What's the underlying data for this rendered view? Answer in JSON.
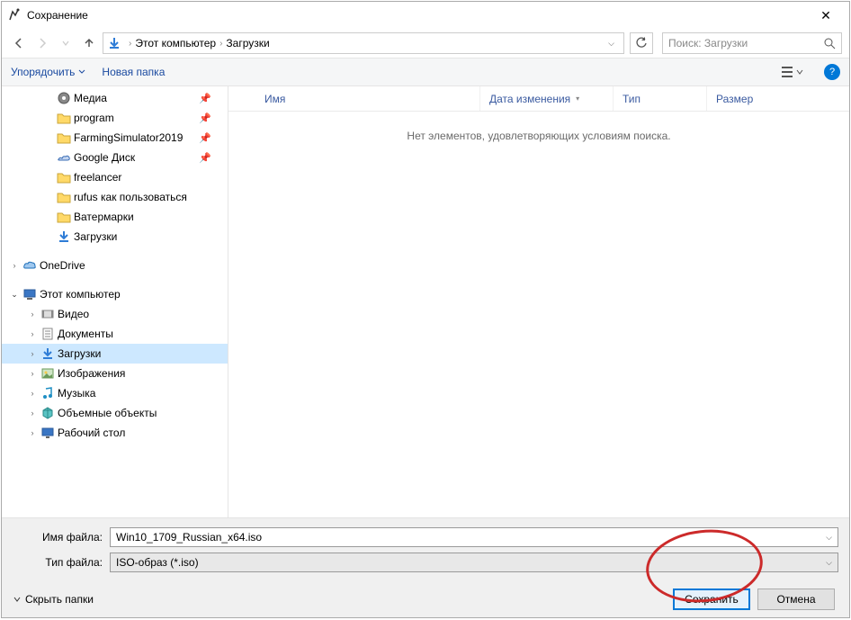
{
  "title": "Сохранение",
  "breadcrumb": {
    "root": "Этот компьютер",
    "folder": "Загрузки"
  },
  "search_placeholder": "Поиск: Загрузки",
  "toolbar": {
    "organize": "Упорядочить",
    "newfolder": "Новая папка"
  },
  "columns": {
    "name": "Имя",
    "date": "Дата изменения",
    "type": "Тип",
    "size": "Размер"
  },
  "empty_msg": "Нет элементов, удовлетворяющих условиям поиска.",
  "tree": {
    "quick": [
      {
        "label": "Медиа",
        "icon": "media",
        "pin": true
      },
      {
        "label": "program",
        "icon": "folder",
        "pin": true
      },
      {
        "label": "FarmingSimulator2019",
        "icon": "folder",
        "pin": true
      },
      {
        "label": "Google Диск",
        "icon": "gdrive",
        "pin": true
      },
      {
        "label": "freelancer",
        "icon": "folder",
        "pin": false
      },
      {
        "label": "rufus как пользоваться",
        "icon": "folder",
        "pin": false
      },
      {
        "label": "Ватермарки",
        "icon": "folder",
        "pin": false
      },
      {
        "label": "Загрузки",
        "icon": "downloads",
        "pin": false
      }
    ],
    "onedrive": "OneDrive",
    "thispc": "Этот компьютер",
    "pc_children": [
      {
        "label": "Видео",
        "icon": "video"
      },
      {
        "label": "Документы",
        "icon": "docs"
      },
      {
        "label": "Загрузки",
        "icon": "downloads",
        "selected": true
      },
      {
        "label": "Изображения",
        "icon": "pictures"
      },
      {
        "label": "Музыка",
        "icon": "music"
      },
      {
        "label": "Объемные объекты",
        "icon": "3d"
      },
      {
        "label": "Рабочий стол",
        "icon": "desktop"
      }
    ]
  },
  "form": {
    "filename_label": "Имя файла:",
    "filename_value": "Win10_1709_Russian_x64.iso",
    "filetype_label": "Тип файла:",
    "filetype_value": "ISO-образ (*.iso)"
  },
  "buttons": {
    "hide": "Скрыть папки",
    "save": "Сохранить",
    "cancel": "Отмена"
  }
}
